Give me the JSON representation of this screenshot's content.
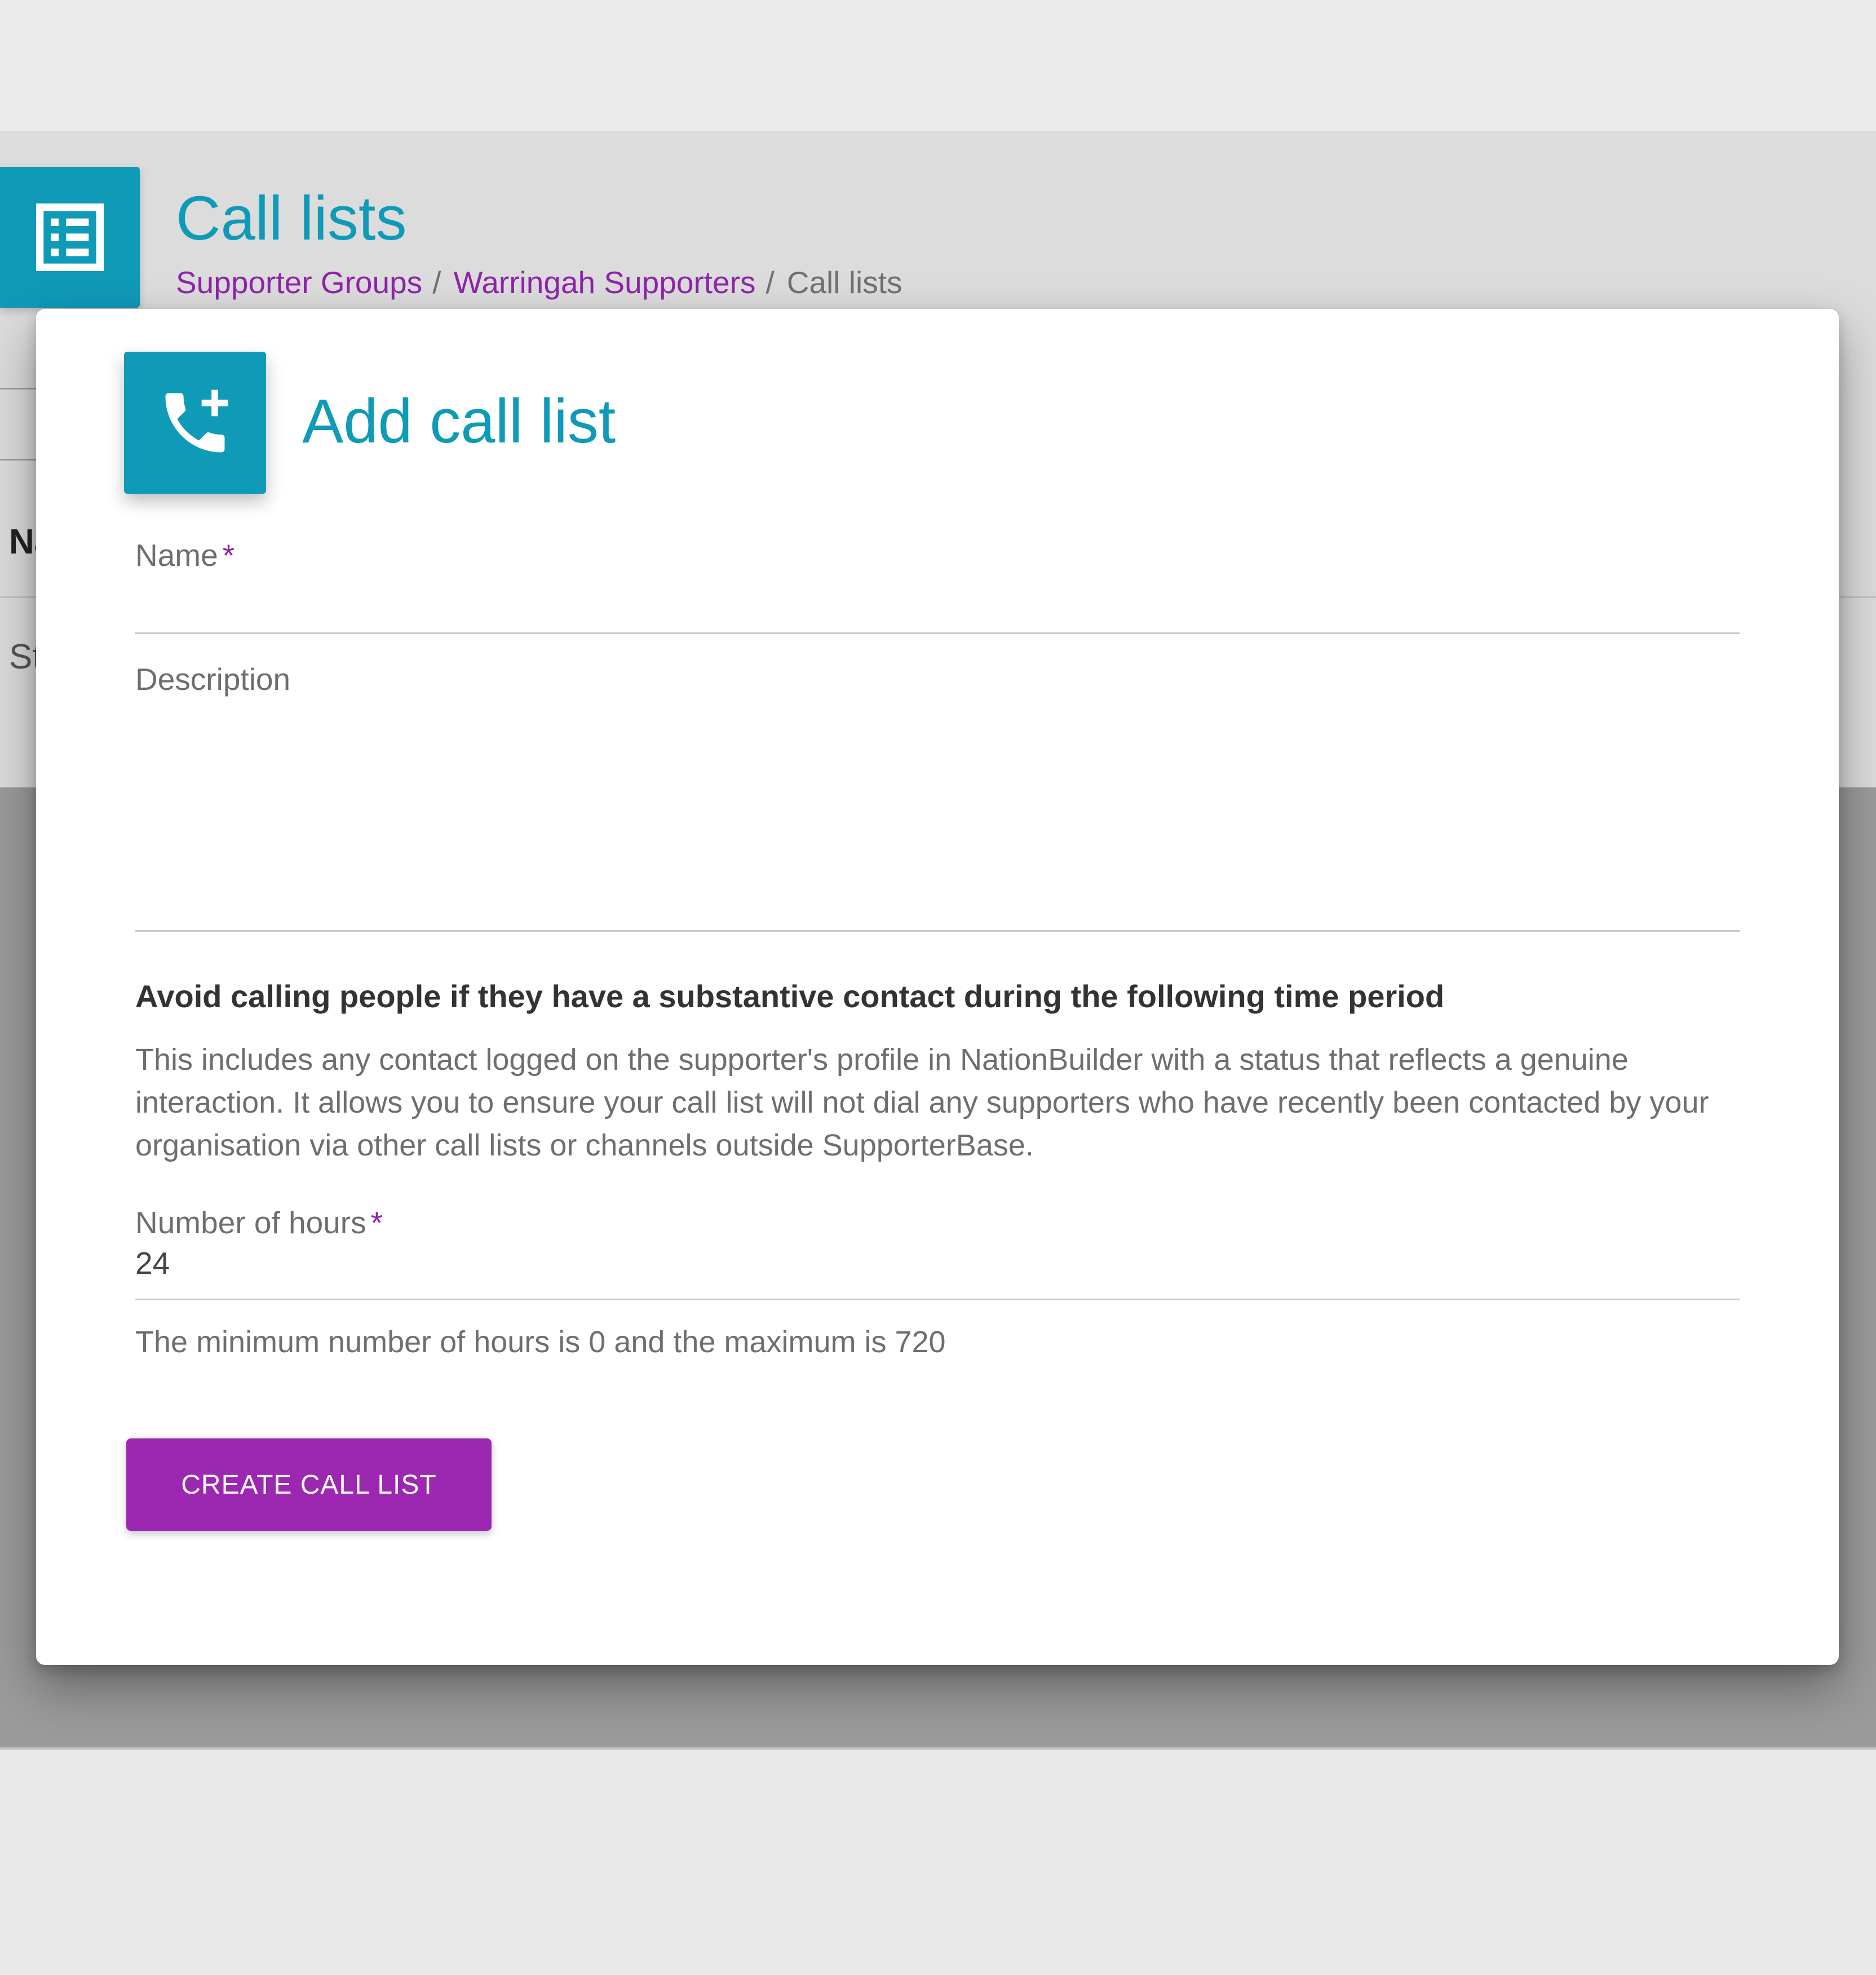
{
  "page": {
    "title": "Call lists",
    "breadcrumb": [
      {
        "label": "Supporter Groups"
      },
      {
        "label": "Warringah Supporters"
      },
      {
        "label": "Call lists"
      }
    ],
    "breadcrumb_separator": "/",
    "icon": "list-icon",
    "background_partial_texts": {
      "column_header": "Na",
      "row_text": "St"
    }
  },
  "modal": {
    "title": "Add call list",
    "icon": "add-call-icon",
    "name_field": {
      "label": "Name",
      "required_mark": "*",
      "value": ""
    },
    "description_field": {
      "label": "Description",
      "value": ""
    },
    "section_heading": "Avoid calling people if they have a substantive contact during the following time period",
    "section_body": "This includes any contact logged on the supporter's profile in NationBuilder with a status that reflects a genuine interaction. It allows you to ensure your call list will not dial any supporters who have recently been contacted by your organisation via other call lists or channels outside SupporterBase.",
    "hours_field": {
      "label": "Number of hours",
      "required_mark": "*",
      "value": "24"
    },
    "hint": "The minimum number of hours is 0 and the maximum is 720",
    "create_button": "CREATE CALL LIST"
  },
  "colors": {
    "accent": "#0f9ab7",
    "link": "#8e24aa",
    "button": "#9c27b0"
  }
}
